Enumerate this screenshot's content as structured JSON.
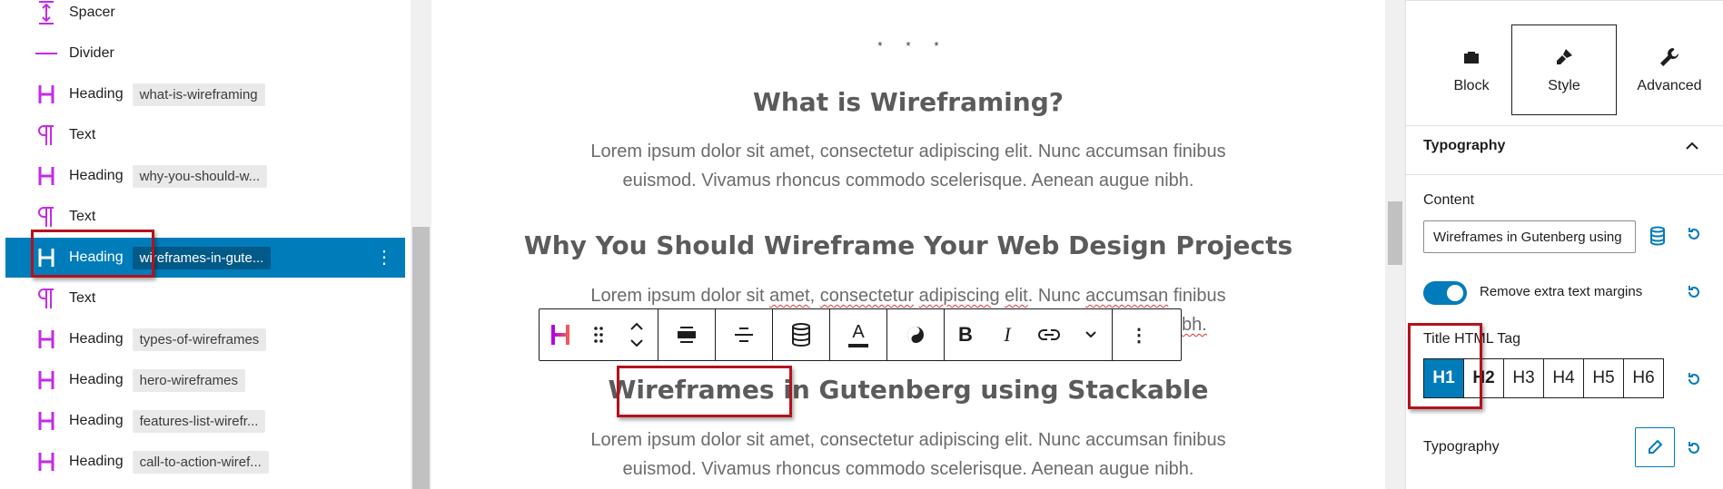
{
  "list_view": {
    "items": [
      {
        "type": "spacer",
        "name": "Spacer",
        "anchor": ""
      },
      {
        "type": "divider",
        "name": "Divider",
        "anchor": ""
      },
      {
        "type": "heading",
        "name": "Heading",
        "anchor": "what-is-wireframing"
      },
      {
        "type": "text",
        "name": "Text",
        "anchor": ""
      },
      {
        "type": "heading",
        "name": "Heading",
        "anchor": "why-you-should-w..."
      },
      {
        "type": "text",
        "name": "Text",
        "anchor": ""
      },
      {
        "type": "heading",
        "name": "Heading",
        "anchor": "wireframes-in-gute...",
        "selected": true
      },
      {
        "type": "text",
        "name": "Text",
        "anchor": ""
      },
      {
        "type": "heading",
        "name": "Heading",
        "anchor": "types-of-wireframes"
      },
      {
        "type": "heading",
        "name": "Heading",
        "anchor": "hero-wireframes"
      },
      {
        "type": "heading",
        "name": "Heading",
        "anchor": "features-list-wirefr..."
      },
      {
        "type": "heading",
        "name": "Heading",
        "anchor": "call-to-action-wiref..."
      }
    ],
    "more_label": "⋮"
  },
  "canvas": {
    "separator": "***",
    "heading1": "What is Wireframing?",
    "para1_line1": "Lorem ipsum dolor sit amet, consectetur adipiscing elit. Nunc accumsan finibus",
    "para1_line2": "euismod. Vivamus rhoncus commodo scelerisque. Aenean augue nibh.",
    "heading2": "Why You Should Wireframe Your Web Design Projects",
    "para2_a": "Lorem ipsum dolor sit ",
    "para2_b": "amet",
    "para2_c": ", ",
    "para2_d": "consectetur",
    "para2_e": " ",
    "para2_f": "adipiscing",
    "para2_g": " ",
    "para2_h": "elit",
    "para2_i": ". Nunc ",
    "para2_j": "accumsan",
    "para2_k": " finibus",
    "para2_tail": "bh.",
    "heading3": "Wireframes in Gutenberg using Stackable",
    "para3_line1": "Lorem ipsum dolor sit amet, consectetur adipiscing elit. Nunc accumsan finibus",
    "para3_line2": "euismod. Vivamus rhoncus commodo scelerisque. Aenean augue nibh."
  },
  "toolbar": {
    "buttons": [
      "heading-block-icon",
      "drag-handle-icon",
      "move-up-down-icon",
      "align-wide-icon",
      "text-align-center-icon",
      "dynamic-content-icon",
      "text-color-icon",
      "style-copy-icon",
      "bold-icon",
      "italic-icon",
      "link-icon",
      "more-formats-icon",
      "options-icon"
    ],
    "bold": "B",
    "italic": "I",
    "color_letter": "A",
    "more": "⋮"
  },
  "sidebar": {
    "tabs": [
      {
        "label": "Block"
      },
      {
        "label": "Style",
        "active": true
      },
      {
        "label": "Advanced"
      }
    ],
    "panel_title": "Typography",
    "content_label": "Content",
    "content_value": "Wireframes in Gutenberg using Stackable",
    "toggle_label": "Remove extra text margins",
    "toggle_on": true,
    "title_tag_label": "Title HTML Tag",
    "tags": [
      "H1",
      "H2",
      "H3",
      "H4",
      "H5",
      "H6"
    ],
    "active_tag": "H1",
    "typography_label": "Typography"
  },
  "colors": {
    "accent": "#007cba",
    "heading_icon": "#c42ae8",
    "highlight": "#b4121b"
  }
}
